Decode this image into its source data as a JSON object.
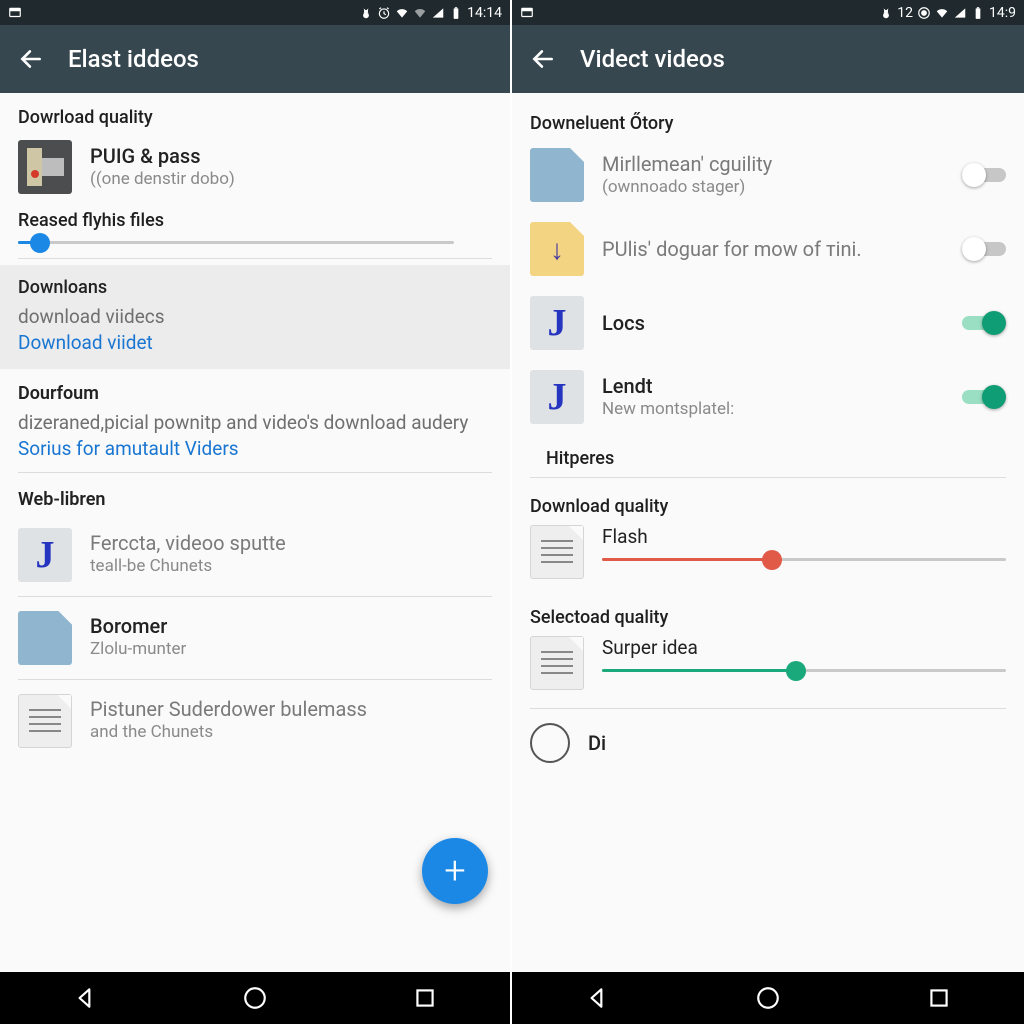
{
  "left": {
    "status": {
      "time": "14:14"
    },
    "title": "Elast iddeos",
    "s1": "Dowrload quality",
    "item1": {
      "title": "PUIG & pass",
      "sub": "((one denstir dobo)"
    },
    "slider_label": "Reased flyhis files",
    "slider": {
      "percent": 5
    },
    "downloads": {
      "hd": "Downloans",
      "l1": "download viidecs",
      "l2": "Download viidet"
    },
    "dourfoum": {
      "hd": "Dourfoum",
      "l1": "dizeraned,picial pownitp and video's download audery",
      "l2": "Sorius for amutault Viders"
    },
    "weblibren": {
      "hd": "Web-libren",
      "items": [
        {
          "title": "Ferccta, videoo sputte",
          "sub": "teall-be Chunets",
          "icon": "j"
        },
        {
          "title": "Boromer",
          "sub": "Zlolu-munter",
          "icon": "doc-blue"
        },
        {
          "title": "Pistuner Suderdower bulemass",
          "sub": "and the Chunets",
          "icon": "doc-lines"
        }
      ]
    }
  },
  "right": {
    "status": {
      "extra": "12",
      "time": "14:9"
    },
    "title": "Videct videos",
    "s1": "Downeluent Őtory",
    "toggles": [
      {
        "title": "Mirllemean' cguility",
        "sub": "(ownnoado stager)",
        "icon": "doc-blue",
        "on": false
      },
      {
        "title": "PUlis' doguar for mow of тini.",
        "sub": "",
        "icon": "doc-yellow",
        "on": false
      },
      {
        "title": "Locs",
        "sub": "",
        "icon": "j",
        "on": true
      },
      {
        "title": "Lendt",
        "sub": "New montsplatel:",
        "icon": "j",
        "on": true
      }
    ],
    "s2": "Hitperes",
    "s3": "Download quality",
    "flash": {
      "label": "Flash",
      "percent": 42
    },
    "s4": "Selectoad quality",
    "surper": {
      "label": "Surper idea",
      "percent": 48
    },
    "last": "Di"
  }
}
